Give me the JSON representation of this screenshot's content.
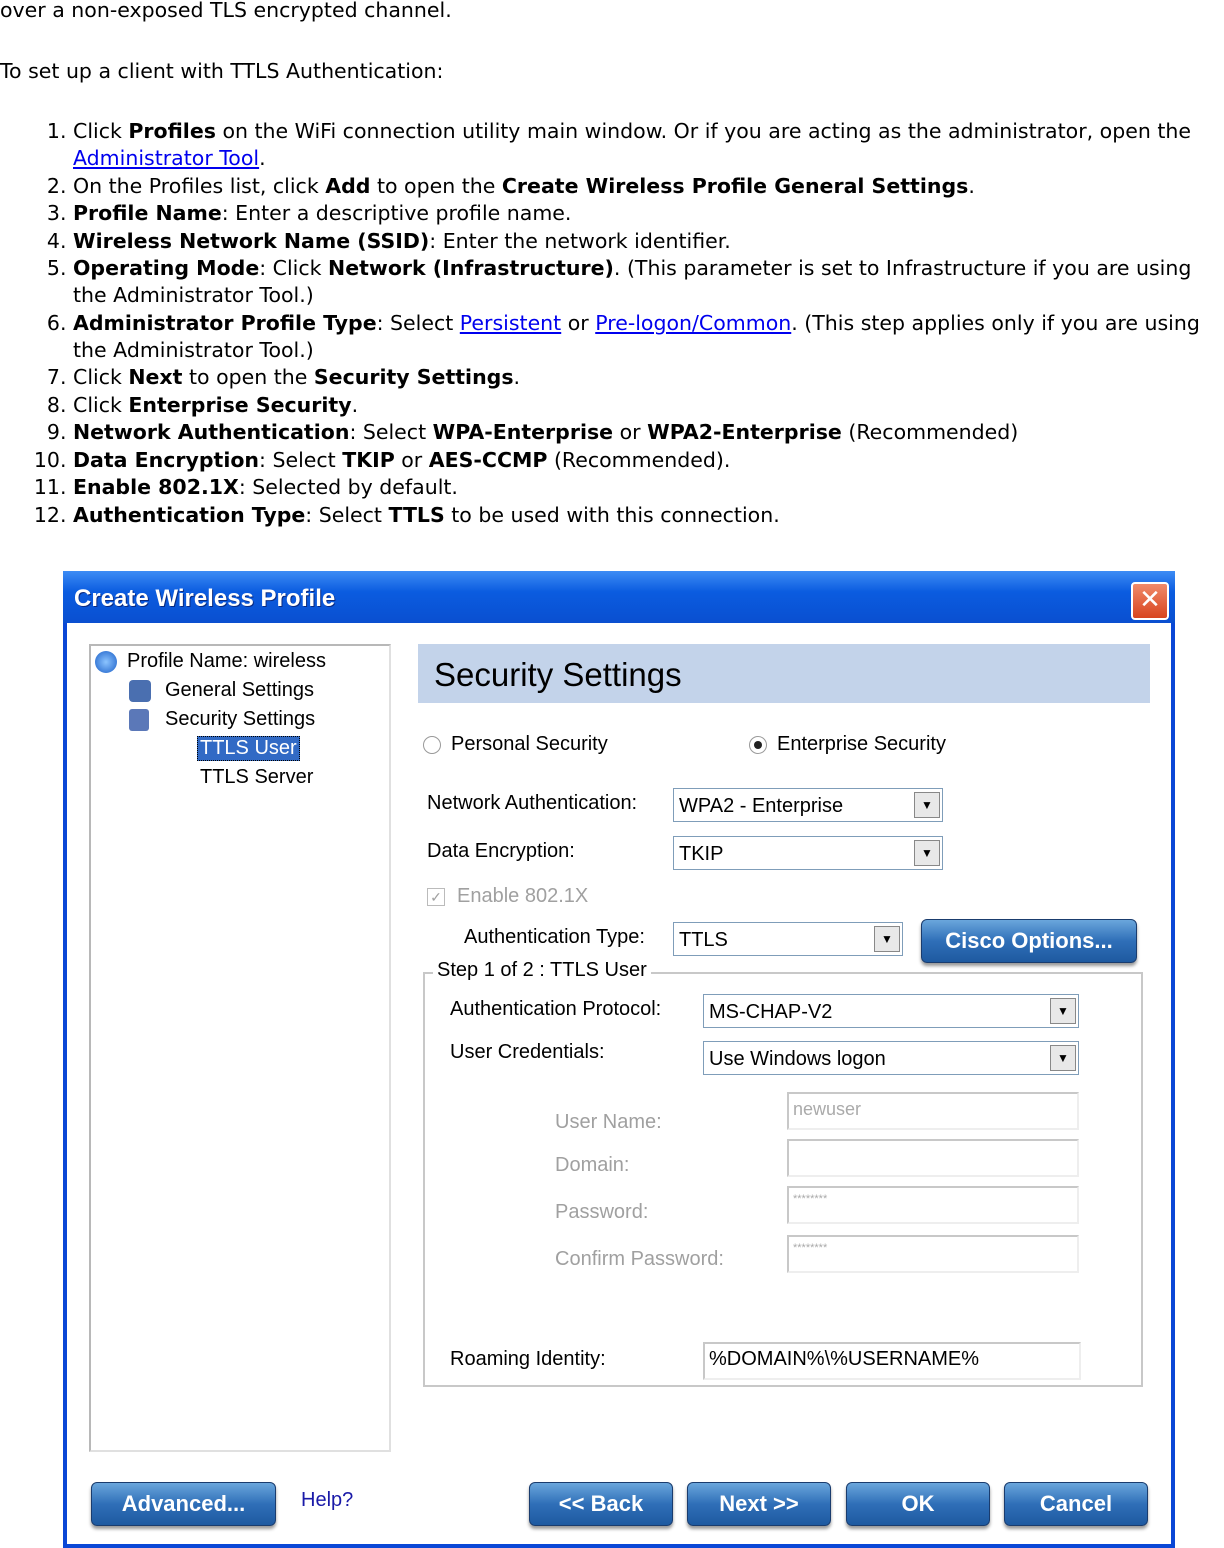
{
  "doc": {
    "intro": "over a non-exposed TLS encrypted channel.",
    "setup": "To set up a client with TTLS Authentication:",
    "steps": [
      [
        {
          "t": "Click "
        },
        {
          "b": "Profiles"
        },
        {
          "t": " on the WiFi connection utility main window. Or if you are acting as the administrator, open the "
        },
        {
          "a": "Administrator Tool"
        },
        {
          "t": "."
        }
      ],
      [
        {
          "t": "On the Profiles list, click "
        },
        {
          "b": "Add"
        },
        {
          "t": " to open the "
        },
        {
          "b": "Create Wireless Profile General Settings"
        },
        {
          "t": "."
        }
      ],
      [
        {
          "b": "Profile Name"
        },
        {
          "t": ": Enter a descriptive profile name."
        }
      ],
      [
        {
          "b": "Wireless Network Name (SSID)"
        },
        {
          "t": ": Enter the network identifier."
        }
      ],
      [
        {
          "b": "Operating Mode"
        },
        {
          "t": ": Click "
        },
        {
          "b": "Network (Infrastructure)"
        },
        {
          "t": ". (This parameter is set to Infrastructure if you are using the Administrator Tool.)"
        }
      ],
      [
        {
          "b": "Administrator Profile Type"
        },
        {
          "t": ": Select "
        },
        {
          "a": "Persistent"
        },
        {
          "t": " or "
        },
        {
          "a": "Pre-logon/Common"
        },
        {
          "t": ". (This step applies only if you are using the Administrator Tool.)"
        }
      ],
      [
        {
          "t": "Click "
        },
        {
          "b": "Next"
        },
        {
          "t": " to open the "
        },
        {
          "b": "Security Settings"
        },
        {
          "t": "."
        }
      ],
      [
        {
          "t": "Click "
        },
        {
          "b": "Enterprise Security"
        },
        {
          "t": "."
        }
      ],
      [
        {
          "b": "Network Authentication"
        },
        {
          "t": ": Select "
        },
        {
          "b": "WPA-Enterprise"
        },
        {
          "t": " or "
        },
        {
          "b": "WPA2-Enterprise"
        },
        {
          "t": " (Recommended)"
        }
      ],
      [
        {
          "b": "Data Encryption"
        },
        {
          "t": ": Select "
        },
        {
          "b": "TKIP"
        },
        {
          "t": " or "
        },
        {
          "b": "AES-CCMP"
        },
        {
          "t": " (Recommended)."
        }
      ],
      [
        {
          "b": "Enable 802.1X"
        },
        {
          "t": ": Selected by default."
        }
      ],
      [
        {
          "b": "Authentication Type"
        },
        {
          "t": ": Select "
        },
        {
          "b": "TTLS"
        },
        {
          "t": " to be used with this connection."
        }
      ]
    ]
  },
  "dialog": {
    "title": "Create Wireless Profile",
    "close_icon": "close-x-icon",
    "tree": {
      "profile": "Profile Name: wireless",
      "general": "General Settings",
      "security": "Security Settings",
      "ttls_user": "TTLS User",
      "ttls_server": "TTLS Server"
    },
    "banner": "Security Settings",
    "personal": "Personal Security",
    "enterprise": "Enterprise Security",
    "selected_security": "enterprise",
    "net_auth_label": "Network Authentication:",
    "net_auth_value": "WPA2 - Enterprise",
    "data_enc_label": "Data Encryption:",
    "data_enc_value": "TKIP",
    "enable_8021x": "Enable 802.1X",
    "enable_8021x_checked": true,
    "auth_type_label": "Authentication Type:",
    "auth_type_value": "TTLS",
    "cisco_options": "Cisco Options...",
    "group_title": "Step 1 of 2 : TTLS User",
    "auth_proto_label": "Authentication Protocol:",
    "auth_proto_value": "MS-CHAP-V2",
    "user_cred_label": "User Credentials:",
    "user_cred_value": "Use Windows logon",
    "user_name_label": "User Name:",
    "user_name_value": "newuser",
    "domain_label": "Domain:",
    "password_label": "Password:",
    "password_value": "********",
    "confirm_label": "Confirm Password:",
    "confirm_value": "********",
    "roaming_label": "Roaming Identity:",
    "roaming_value": "%DOMAIN%\\%USERNAME%",
    "buttons": {
      "advanced": "Advanced...",
      "help": "Help?",
      "back": "<< Back",
      "next": "Next >>",
      "ok": "OK",
      "cancel": "Cancel"
    }
  }
}
